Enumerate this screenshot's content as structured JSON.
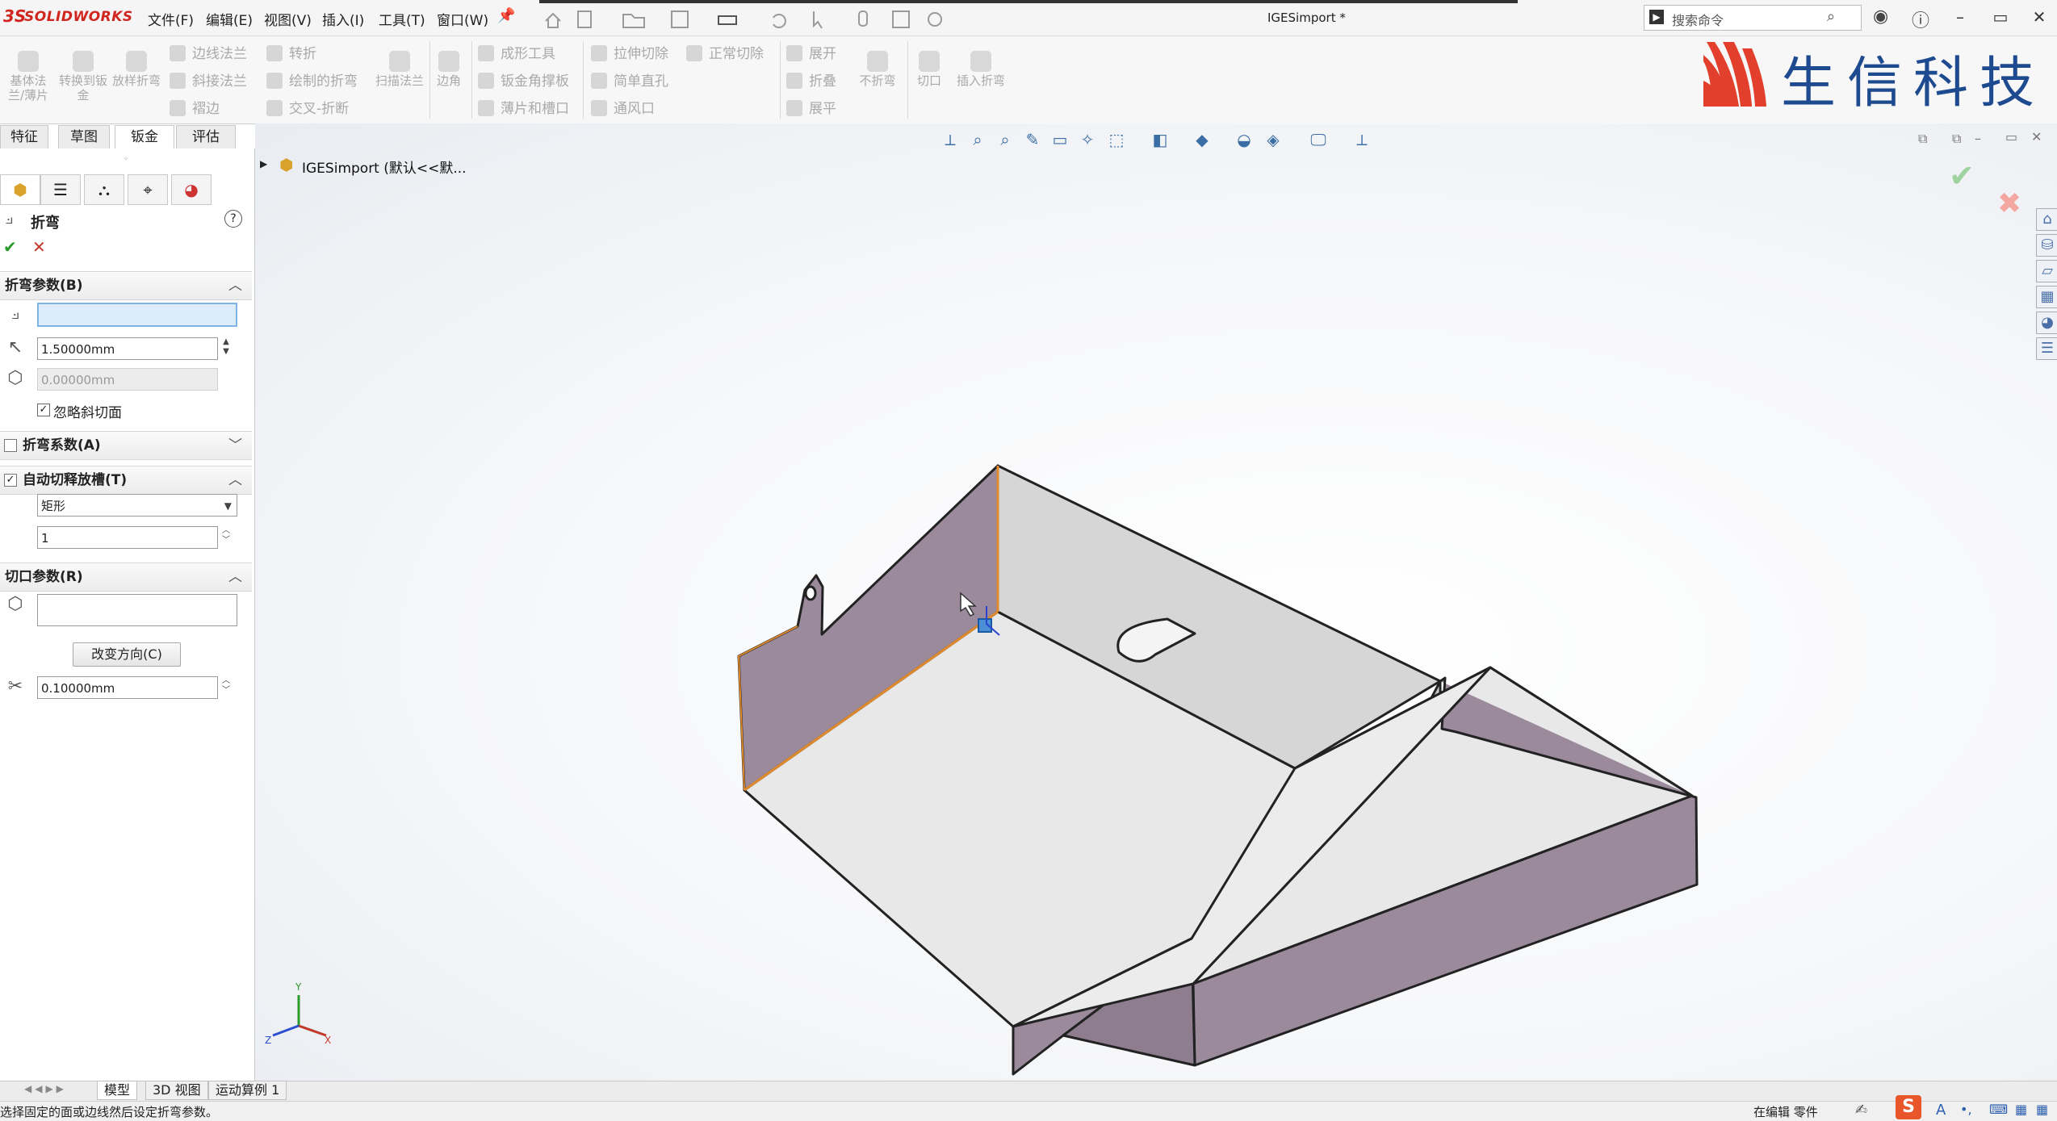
{
  "app": {
    "logo_ds": "3S",
    "logo_name": "SOLIDWORKS",
    "doc_title": "IGESimport *"
  },
  "menu": [
    "文件(F)",
    "编辑(E)",
    "视图(V)",
    "插入(I)",
    "工具(T)",
    "窗口(W)"
  ],
  "search": {
    "placeholder": "搜索命令"
  },
  "window_controls": {
    "minimize": "–",
    "restore": "▭",
    "close": "✕"
  },
  "ribbon": {
    "big_buttons": [
      "基体法兰/薄片",
      "转换到钣金",
      "放样折弯",
      "扫描法兰",
      "边角",
      "不折弯",
      "切口",
      "插入折弯"
    ],
    "small_buttons": [
      "边线法兰",
      "斜接法兰",
      "褶边",
      "转折",
      "绘制的折弯",
      "交叉-折断",
      "成形工具",
      "钣金角撑板",
      "薄片和槽口",
      "拉伸切除",
      "简单直孔",
      "通风口",
      "正常切除",
      "展开",
      "折叠",
      "展平"
    ]
  },
  "brand": {
    "text": "生信科技"
  },
  "tabs": [
    "特征",
    "草图",
    "钣金",
    "评估"
  ],
  "panel": {
    "feature_title": "折弯",
    "help": "?",
    "ok": "✔",
    "cancel": "✕",
    "bend_params": {
      "title": "折弯参数(B)",
      "radius": "1.50000mm",
      "disabled_value": "0.00000mm",
      "ignore_bevel_label": "忽略斜切面",
      "ignore_bevel_checked": true
    },
    "bend_allowance": {
      "title": "折弯系数(A)",
      "checked": false
    },
    "auto_relief": {
      "title": "自动切释放槽(T)",
      "checked": true,
      "type": "矩形",
      "ratio": "1"
    },
    "rip_params": {
      "title": "切口参数(R)",
      "reverse_button": "改变方向(C)",
      "gap": "0.10000mm"
    }
  },
  "tree": {
    "root": "IGESimport  (默认<<默..."
  },
  "bottom_tabs": [
    "模型",
    "3D 视图",
    "运动算例 1"
  ],
  "status": {
    "message": "选择固定的面或边线然后设定折弯参数。",
    "mode": "在编辑 零件"
  },
  "colors": {
    "accent": "#d1261f",
    "brand_blue": "#1e4a8f",
    "face_purple": "#9a8a9c",
    "face_gray": "#e6e6e6",
    "highlight_orange": "#e08a2c"
  }
}
